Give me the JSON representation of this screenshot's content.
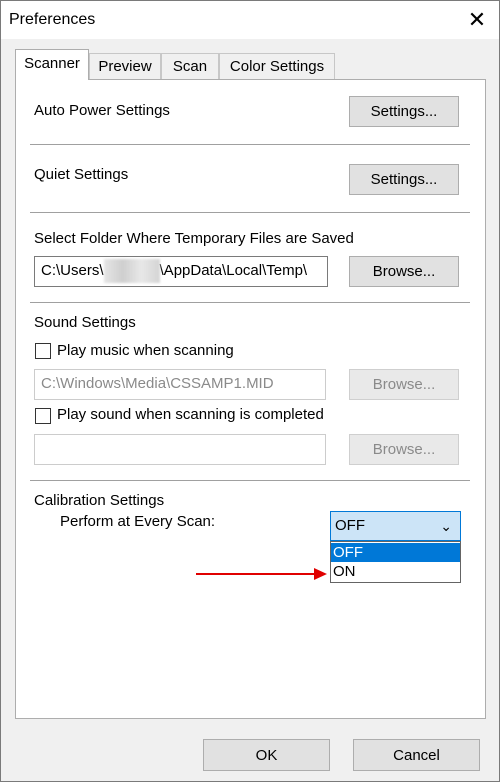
{
  "window": {
    "title": "Preferences"
  },
  "tabs": [
    {
      "label": "Scanner",
      "active": true
    },
    {
      "label": "Preview",
      "active": false
    },
    {
      "label": "Scan",
      "active": false
    },
    {
      "label": "Color Settings",
      "active": false
    }
  ],
  "auto_power": {
    "label": "Auto Power Settings",
    "button": "Settings..."
  },
  "quiet": {
    "label": "Quiet Settings",
    "button": "Settings..."
  },
  "temp_folder": {
    "label": "Select Folder Where Temporary Files are Saved",
    "path_prefix": "C:\\Users\\",
    "path_suffix": "\\AppData\\Local\\Temp\\",
    "button": "Browse..."
  },
  "sound": {
    "label": "Sound Settings",
    "music_checkbox": {
      "label": "Play music when scanning",
      "checked": false
    },
    "music_path": "C:\\Windows\\Media\\CSSAMP1.MID",
    "browse1": "Browse...",
    "complete_checkbox": {
      "label": "Play sound when scanning is completed",
      "checked": false
    },
    "complete_path": "",
    "browse2": "Browse..."
  },
  "calibration": {
    "label": "Calibration Settings",
    "perform_label": "Perform at Every Scan:",
    "selected": "OFF",
    "options": [
      "OFF",
      "ON"
    ]
  },
  "footer": {
    "ok": "OK",
    "cancel": "Cancel"
  },
  "colors": {
    "selection_blue": "#0078d7",
    "arrow_red": "#e00000",
    "combo_fill": "#cce4f7"
  },
  "icons": {
    "close": "close-icon",
    "dropdown": "chevron-down-icon",
    "arrow": "red-arrow-icon"
  }
}
